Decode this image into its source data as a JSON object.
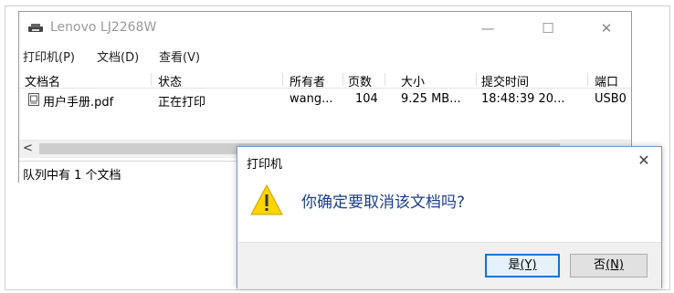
{
  "queue_window": {
    "title": "Lenovo LJ2268W",
    "controls": {
      "minimize": "—",
      "maximize": "☐",
      "close": "✕"
    },
    "menu": [
      "打印机(P)",
      "文档(D)",
      "查看(V)"
    ],
    "columns": [
      "文档名",
      "状态",
      "所有者",
      "页数",
      "大小",
      "提交时间",
      "端口"
    ],
    "rows": [
      {
        "document": "用户手册.pdf",
        "status": "正在打印",
        "owner": "wang...",
        "pages": "104",
        "size": "9.25 MB...",
        "submitted": "18:48:39  20...",
        "port": "USB0"
      }
    ],
    "scroll_left": "<",
    "status_text": "队列中有 1 个文档"
  },
  "dialog": {
    "title": "打印机",
    "close": "✕",
    "message": "你确定要取消该文档吗?",
    "yes_label": "是",
    "yes_key": "(Y)",
    "no_label": "否",
    "no_key": "(N)",
    "accent_color": "#0078d7",
    "message_color": "#1a3e8f"
  }
}
